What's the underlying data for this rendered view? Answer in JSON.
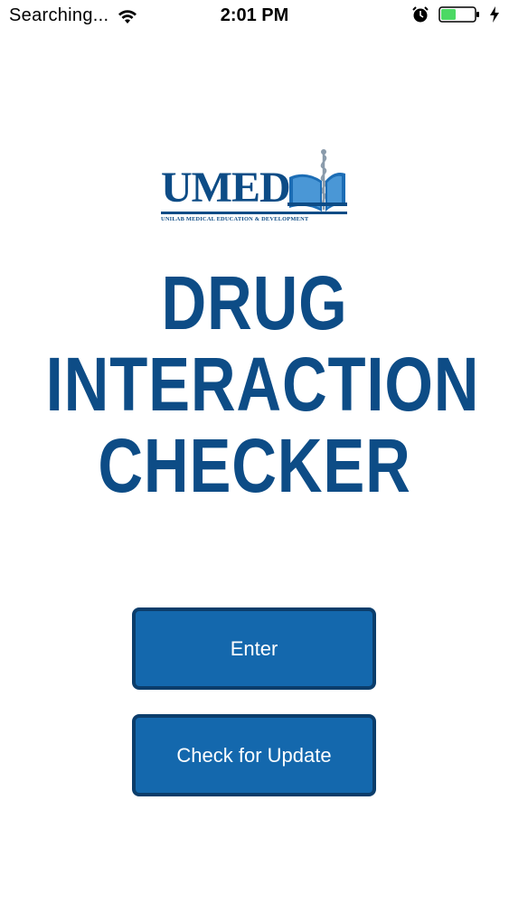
{
  "status_bar": {
    "carrier": "Searching...",
    "time": "2:01 PM",
    "icons": [
      "wifi-icon",
      "alarm-icon",
      "battery-icon",
      "charging-bolt-icon"
    ],
    "battery_color": "#4cd964"
  },
  "logo": {
    "wordmark": "UMED",
    "subtitle": "UNILAB MEDICAL EDUCATION & DEVELOPMENT"
  },
  "title": {
    "line1": "DRUG",
    "line2": "INTERACTION",
    "line3": "CHECKER"
  },
  "buttons": {
    "enter": "Enter",
    "check_update": "Check for Update"
  },
  "colors": {
    "brand_blue": "#0d4c86",
    "button_fill": "#1468ad",
    "button_border": "#0b3d6b"
  }
}
